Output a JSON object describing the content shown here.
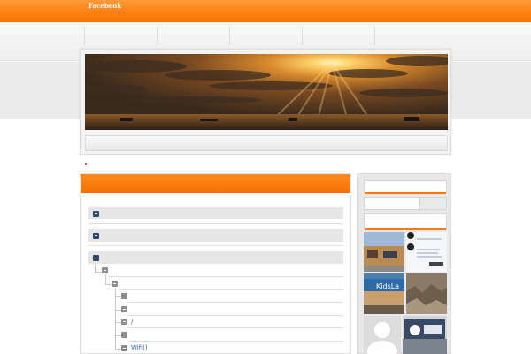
{
  "topbar": {
    "facebook_label": "Facebook"
  },
  "nav": {
    "items": [
      "",
      "",
      "",
      "",
      ""
    ]
  },
  "tree": {
    "item_slash": "/",
    "item_wifi": "Wifi()"
  },
  "colors": {
    "accent": "#f57a10",
    "nav_bg": "#f4f4f4",
    "link": "#2a5db0"
  }
}
